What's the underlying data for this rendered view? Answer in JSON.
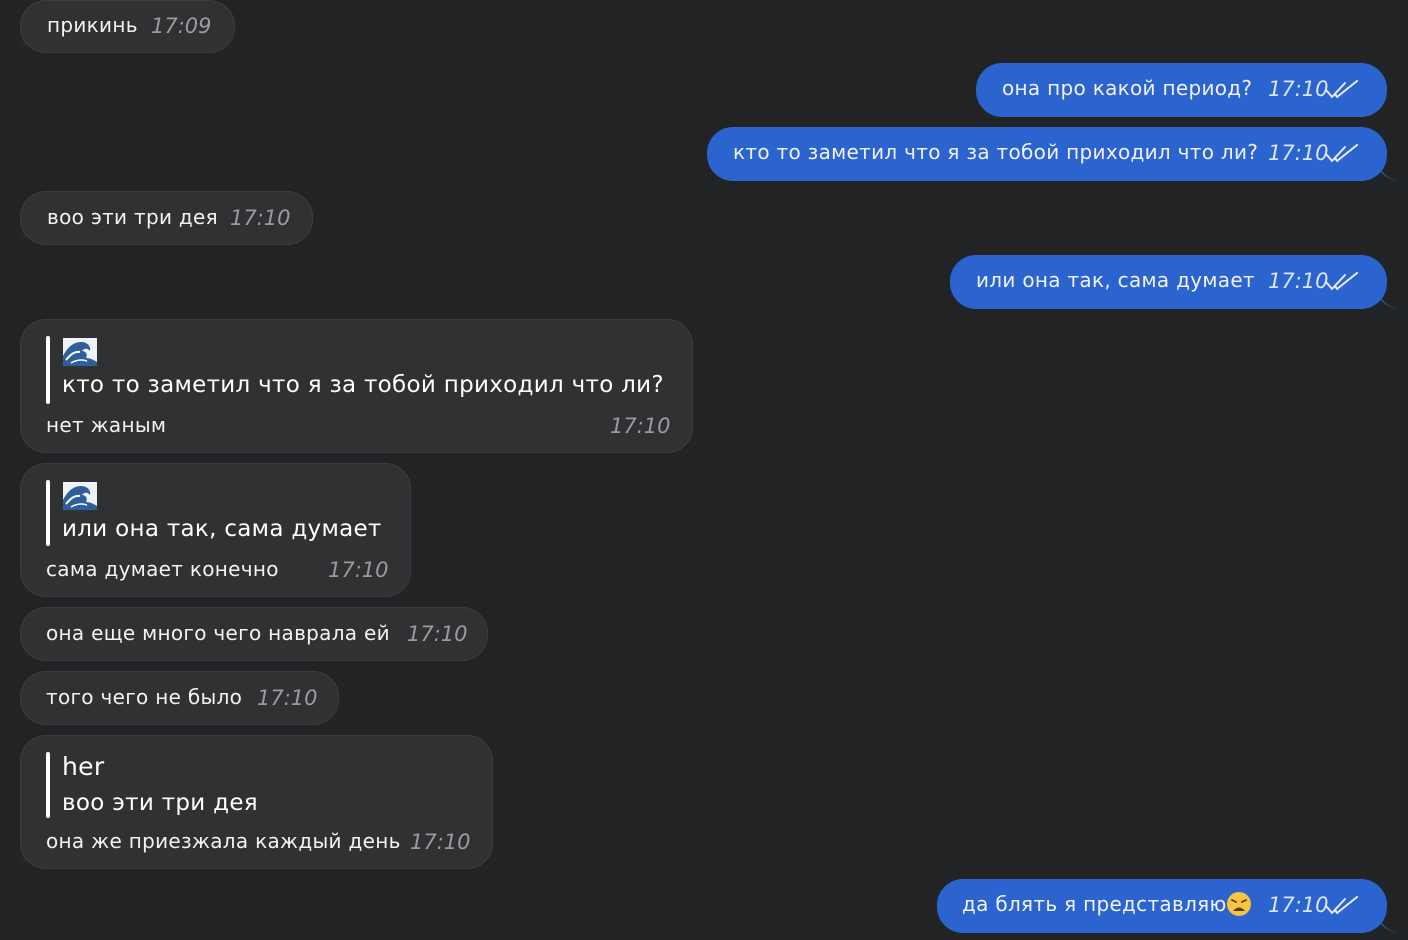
{
  "messages": [
    {
      "id": "m1",
      "side": "in",
      "text": "прикинь",
      "time": "17:09"
    },
    {
      "id": "m2",
      "side": "out",
      "text": "она про какой период?",
      "time": "17:10",
      "status_icon": "double-check-icon"
    },
    {
      "id": "m3",
      "side": "out",
      "text": "кто то заметил что я за тобой приходил что ли?",
      "time": "17:10",
      "status_icon": "double-check-icon"
    },
    {
      "id": "m4",
      "side": "in",
      "text": "воо эти три дея",
      "time": "17:10"
    },
    {
      "id": "m5",
      "side": "out",
      "text": "или она так, сама думает",
      "time": "17:10",
      "status_icon": "double-check-icon"
    },
    {
      "id": "m6",
      "side": "in",
      "reply": {
        "sender_icon": "wave-emoji",
        "text": "кто то заметил что я за тобой приходил что ли?"
      },
      "text": "нет жаным",
      "time": "17:10"
    },
    {
      "id": "m7",
      "side": "in",
      "reply": {
        "sender_icon": "wave-emoji",
        "text": "или она так, сама думает"
      },
      "text": "сама думает конечно",
      "time": "17:10"
    },
    {
      "id": "m8",
      "side": "in",
      "text": "она еще много чего наврала ей",
      "time": "17:10"
    },
    {
      "id": "m9",
      "side": "in",
      "text": "того чего не было",
      "time": "17:10"
    },
    {
      "id": "m10",
      "side": "in",
      "reply": {
        "sender": "her",
        "text": "воо эти три дея"
      },
      "text": "она же приезжала каждый день",
      "time": "17:10"
    },
    {
      "id": "m11",
      "side": "out",
      "text": "да блять я представляю",
      "emoji": "weary-face-emoji",
      "time": "17:10",
      "status_icon": "double-check-icon"
    }
  ],
  "colors": {
    "background": "#212325",
    "incoming_bubble": "#303133",
    "outgoing_bubble": "#2b63cf",
    "text": "#f2f2f2"
  }
}
